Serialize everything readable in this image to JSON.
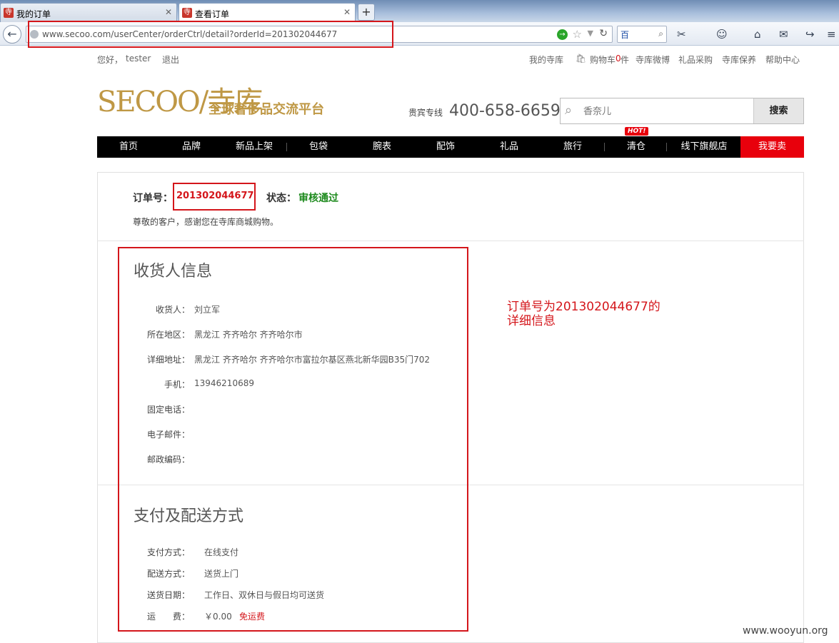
{
  "browser": {
    "tabs": [
      {
        "label": "我的订单",
        "icon": "secoo-favicon-icon"
      },
      {
        "label": "查看订单",
        "icon": "secoo-favicon-icon"
      }
    ],
    "url": "www.secoo.com/userCenter/orderCtrl/detail?orderId=201302044677",
    "search_engine": "百"
  },
  "site": {
    "greeting": "您好，",
    "username": "tester",
    "logout": "退出",
    "top_links": [
      "我的寺库",
      "购物车",
      "0",
      "件",
      "寺库微博",
      "礼品采购",
      "寺库保养",
      "帮助中心"
    ],
    "logo_text": "SECOO/寺库",
    "logo_slogan": "全球奢侈品交流平台",
    "hotline_label": "贵宾专线",
    "hotline": "400-658-6659",
    "search_placeholder": "香奈儿",
    "search_button": "搜索",
    "nav": [
      "首页",
      "品牌",
      "新品上架",
      "包袋",
      "腕表",
      "配饰",
      "礼品",
      "旅行",
      "清仓",
      "线下旗舰店"
    ],
    "nav_sell": "我要卖",
    "hot_badge": "HOT!"
  },
  "order": {
    "number_label": "订单号：",
    "number": "201302044677",
    "status_label": "状态：",
    "status": "审核通过",
    "greeting": "尊敬的客户，感谢您在寺库商城购物。"
  },
  "receiver": {
    "title": "收货人信息",
    "fields": [
      {
        "label": "收货人：",
        "value": "刘立军"
      },
      {
        "label": "所在地区：",
        "value": "黑龙江 齐齐哈尔 齐齐哈尔市"
      },
      {
        "label": "详细地址：",
        "value": "黑龙江 齐齐哈尔 齐齐哈尔市富拉尔基区燕北新华园B35门702"
      },
      {
        "label": "手机：",
        "value": "13946210689"
      },
      {
        "label": "固定电话：",
        "value": ""
      },
      {
        "label": "电子邮件：",
        "value": ""
      },
      {
        "label": "邮政编码：",
        "value": ""
      }
    ]
  },
  "payment": {
    "title": "支付及配送方式",
    "fields": [
      {
        "label": "支付方式：",
        "value": "在线支付"
      },
      {
        "label": "配送方式：",
        "value": "送货上门"
      },
      {
        "label": "送货日期：",
        "value": "工作日、双休日与假日均可送货"
      },
      {
        "label": "运　　费：",
        "value": "￥0.00"
      }
    ],
    "free_shipping": "免运费"
  },
  "annotation": {
    "line1": "订单号为201302044677的",
    "line2": "详细信息"
  },
  "watermark": "www.wooyun.org",
  "colors": {
    "highlight_red": "#d4161b",
    "status_green": "#1d8a1d",
    "brand_gold": "#bf9845",
    "nav_black": "#000000",
    "sell_red": "#e8000c"
  }
}
